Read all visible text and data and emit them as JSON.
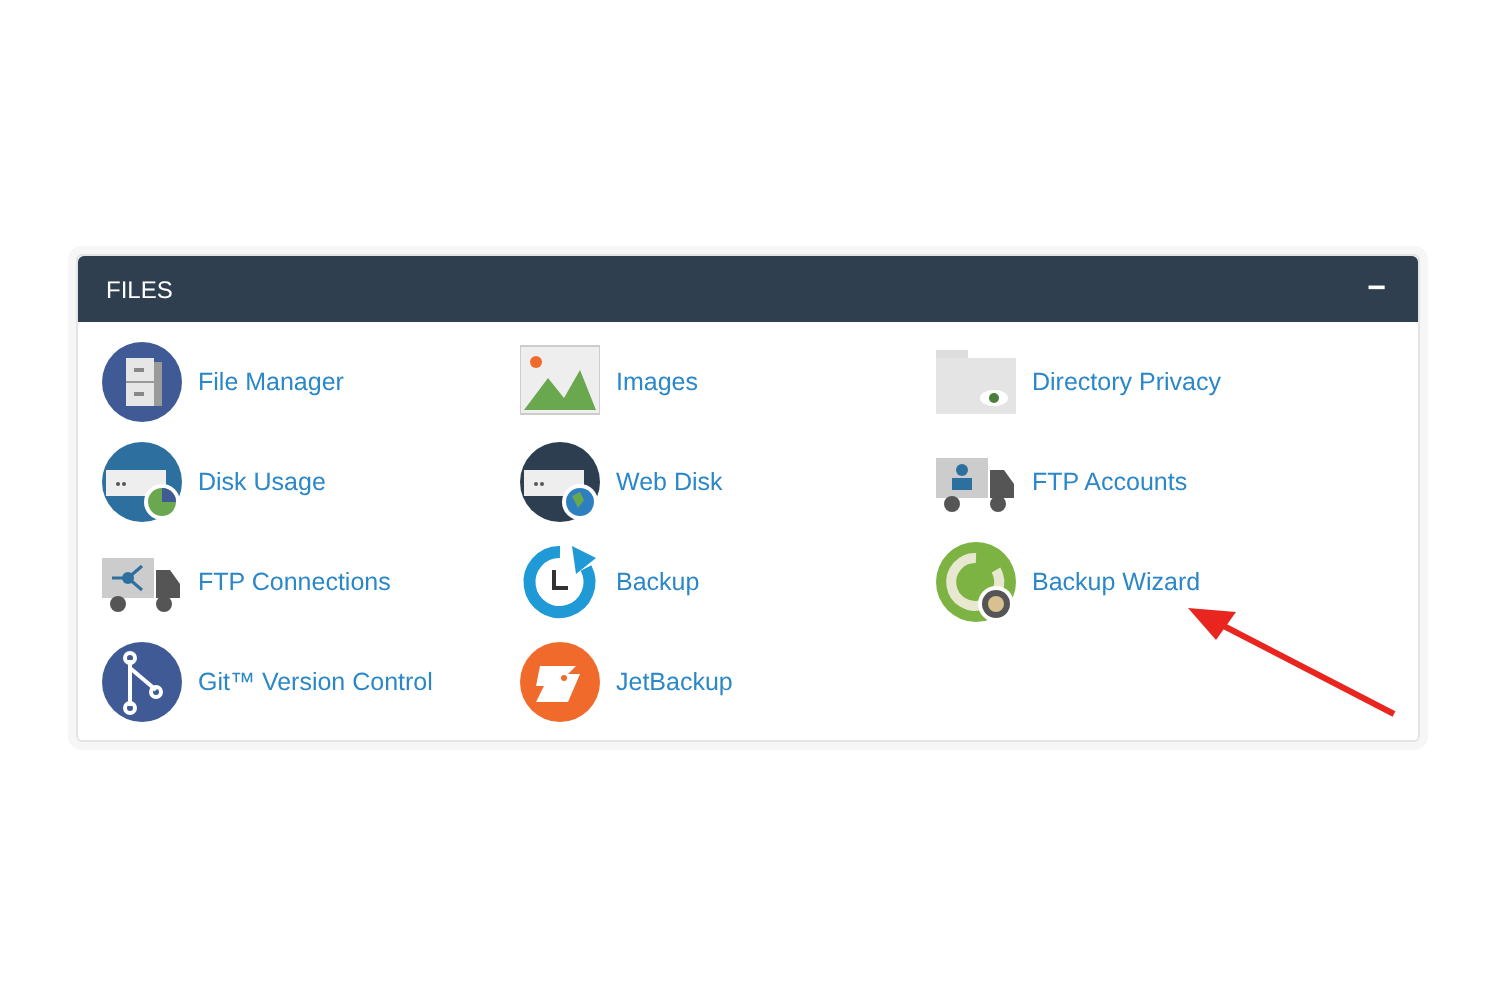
{
  "panel": {
    "title": "FILES",
    "toggle": "−"
  },
  "items": [
    {
      "label": "File Manager"
    },
    {
      "label": "Images"
    },
    {
      "label": "Directory Privacy"
    },
    {
      "label": "Disk Usage"
    },
    {
      "label": "Web Disk"
    },
    {
      "label": "FTP Accounts"
    },
    {
      "label": "FTP Connections"
    },
    {
      "label": "Backup"
    },
    {
      "label": "Backup Wizard"
    },
    {
      "label": "Git™ Version Control"
    },
    {
      "label": "JetBackup"
    }
  ]
}
